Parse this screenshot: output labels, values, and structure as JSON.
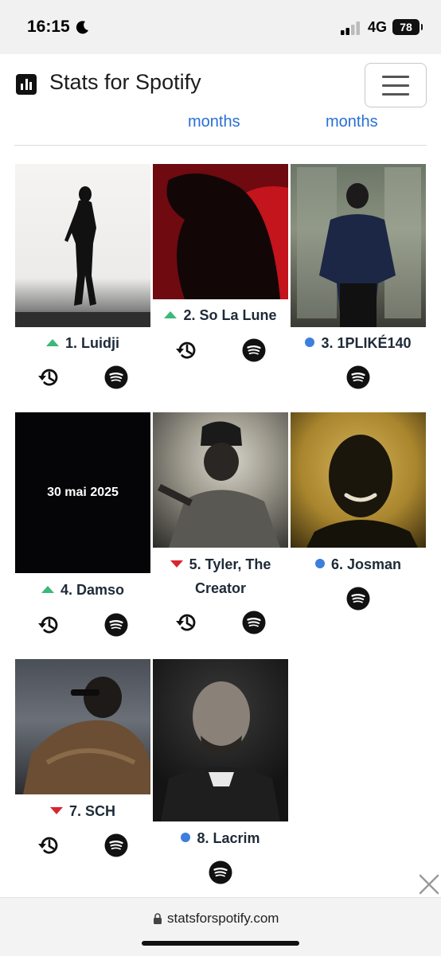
{
  "status_bar": {
    "time": "16:15",
    "network": "4G",
    "battery": "78"
  },
  "navbar": {
    "brand_title": "Stats for Spotify"
  },
  "period_tabs": [
    "months",
    "months"
  ],
  "artists": [
    {
      "rank_label": "1. Luidji",
      "trend": "up"
    },
    {
      "rank_label": "2. So La Lune",
      "trend": "up"
    },
    {
      "rank_label": "3. 1PLIKÉ140",
      "trend": "new"
    },
    {
      "rank_label": "4. Damso",
      "trend": "up",
      "image_text": "30 mai 2025"
    },
    {
      "rank_label_line1": "5. Tyler, The",
      "rank_label_line2": "Creator",
      "trend": "down"
    },
    {
      "rank_label": "6. Josman",
      "trend": "new"
    },
    {
      "rank_label": "7. SCH",
      "trend": "down"
    },
    {
      "rank_label": "8. Lacrim",
      "trend": "new"
    }
  ],
  "browser": {
    "url": "statsforspotify.com"
  },
  "colors": {
    "trend_up": "#3cb878",
    "trend_down": "#d8262e",
    "trend_new": "#3d7fdc",
    "link": "#2a6fd6"
  },
  "icons": [
    "moon-icon",
    "signal-icon",
    "battery-icon",
    "history-icon",
    "spotify-icon",
    "lock-icon",
    "close-icon"
  ]
}
